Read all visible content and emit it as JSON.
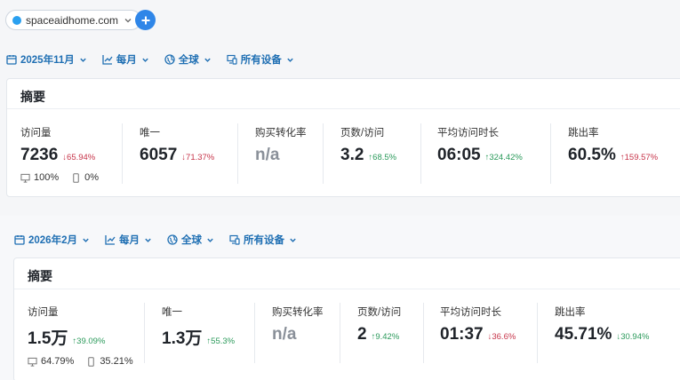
{
  "site": {
    "domain": "spaceaidhome.com",
    "dot_color": "#2aa0f0"
  },
  "sections": [
    {
      "filters": {
        "date": "2025年11月",
        "interval": "每月",
        "region": "全球",
        "device": "所有设备"
      },
      "title": "摘要",
      "metrics": [
        {
          "label": "访问量",
          "value": "7236",
          "change": "65.94%",
          "dir": "down",
          "arrow": "↓"
        },
        {
          "label": "唯一",
          "value": "6057",
          "change": "71.37%",
          "dir": "down",
          "arrow": "↓"
        },
        {
          "label": "购买转化率",
          "value": "n/a",
          "change": "",
          "dir": "",
          "arrow": ""
        },
        {
          "label": "页数/访问",
          "value": "3.2",
          "change": "68.5%",
          "dir": "up",
          "arrow": "↑"
        },
        {
          "label": "平均访问时长",
          "value": "06:05",
          "change": "324.42%",
          "dir": "up",
          "arrow": "↑"
        },
        {
          "label": "跳出率",
          "value": "60.5%",
          "change": "159.57%",
          "dir": "down",
          "arrow": "↑"
        }
      ],
      "devices": {
        "desktop": "100%",
        "mobile": "0%"
      }
    },
    {
      "filters": {
        "date": "2026年2月",
        "interval": "每月",
        "region": "全球",
        "device": "所有设备"
      },
      "title": "摘要",
      "metrics": [
        {
          "label": "访问量",
          "value": "1.5万",
          "change": "39.09%",
          "dir": "up",
          "arrow": "↑"
        },
        {
          "label": "唯一",
          "value": "1.3万",
          "change": "55.3%",
          "dir": "up",
          "arrow": "↑"
        },
        {
          "label": "购买转化率",
          "value": "n/a",
          "change": "",
          "dir": "",
          "arrow": ""
        },
        {
          "label": "页数/访问",
          "value": "2",
          "change": "9.42%",
          "dir": "up",
          "arrow": "↑"
        },
        {
          "label": "平均访问时长",
          "value": "01:37",
          "change": "36.6%",
          "dir": "down",
          "arrow": "↓"
        },
        {
          "label": "跳出率",
          "value": "45.71%",
          "change": "30.94%",
          "dir": "up",
          "arrow": "↓"
        }
      ],
      "devices": {
        "desktop": "64.79%",
        "mobile": "35.21%"
      }
    }
  ],
  "colors": {
    "accent": "#1f6fb3",
    "up": "#2b9a5b",
    "down": "#c7354a",
    "add_button": "#2f86e8"
  }
}
